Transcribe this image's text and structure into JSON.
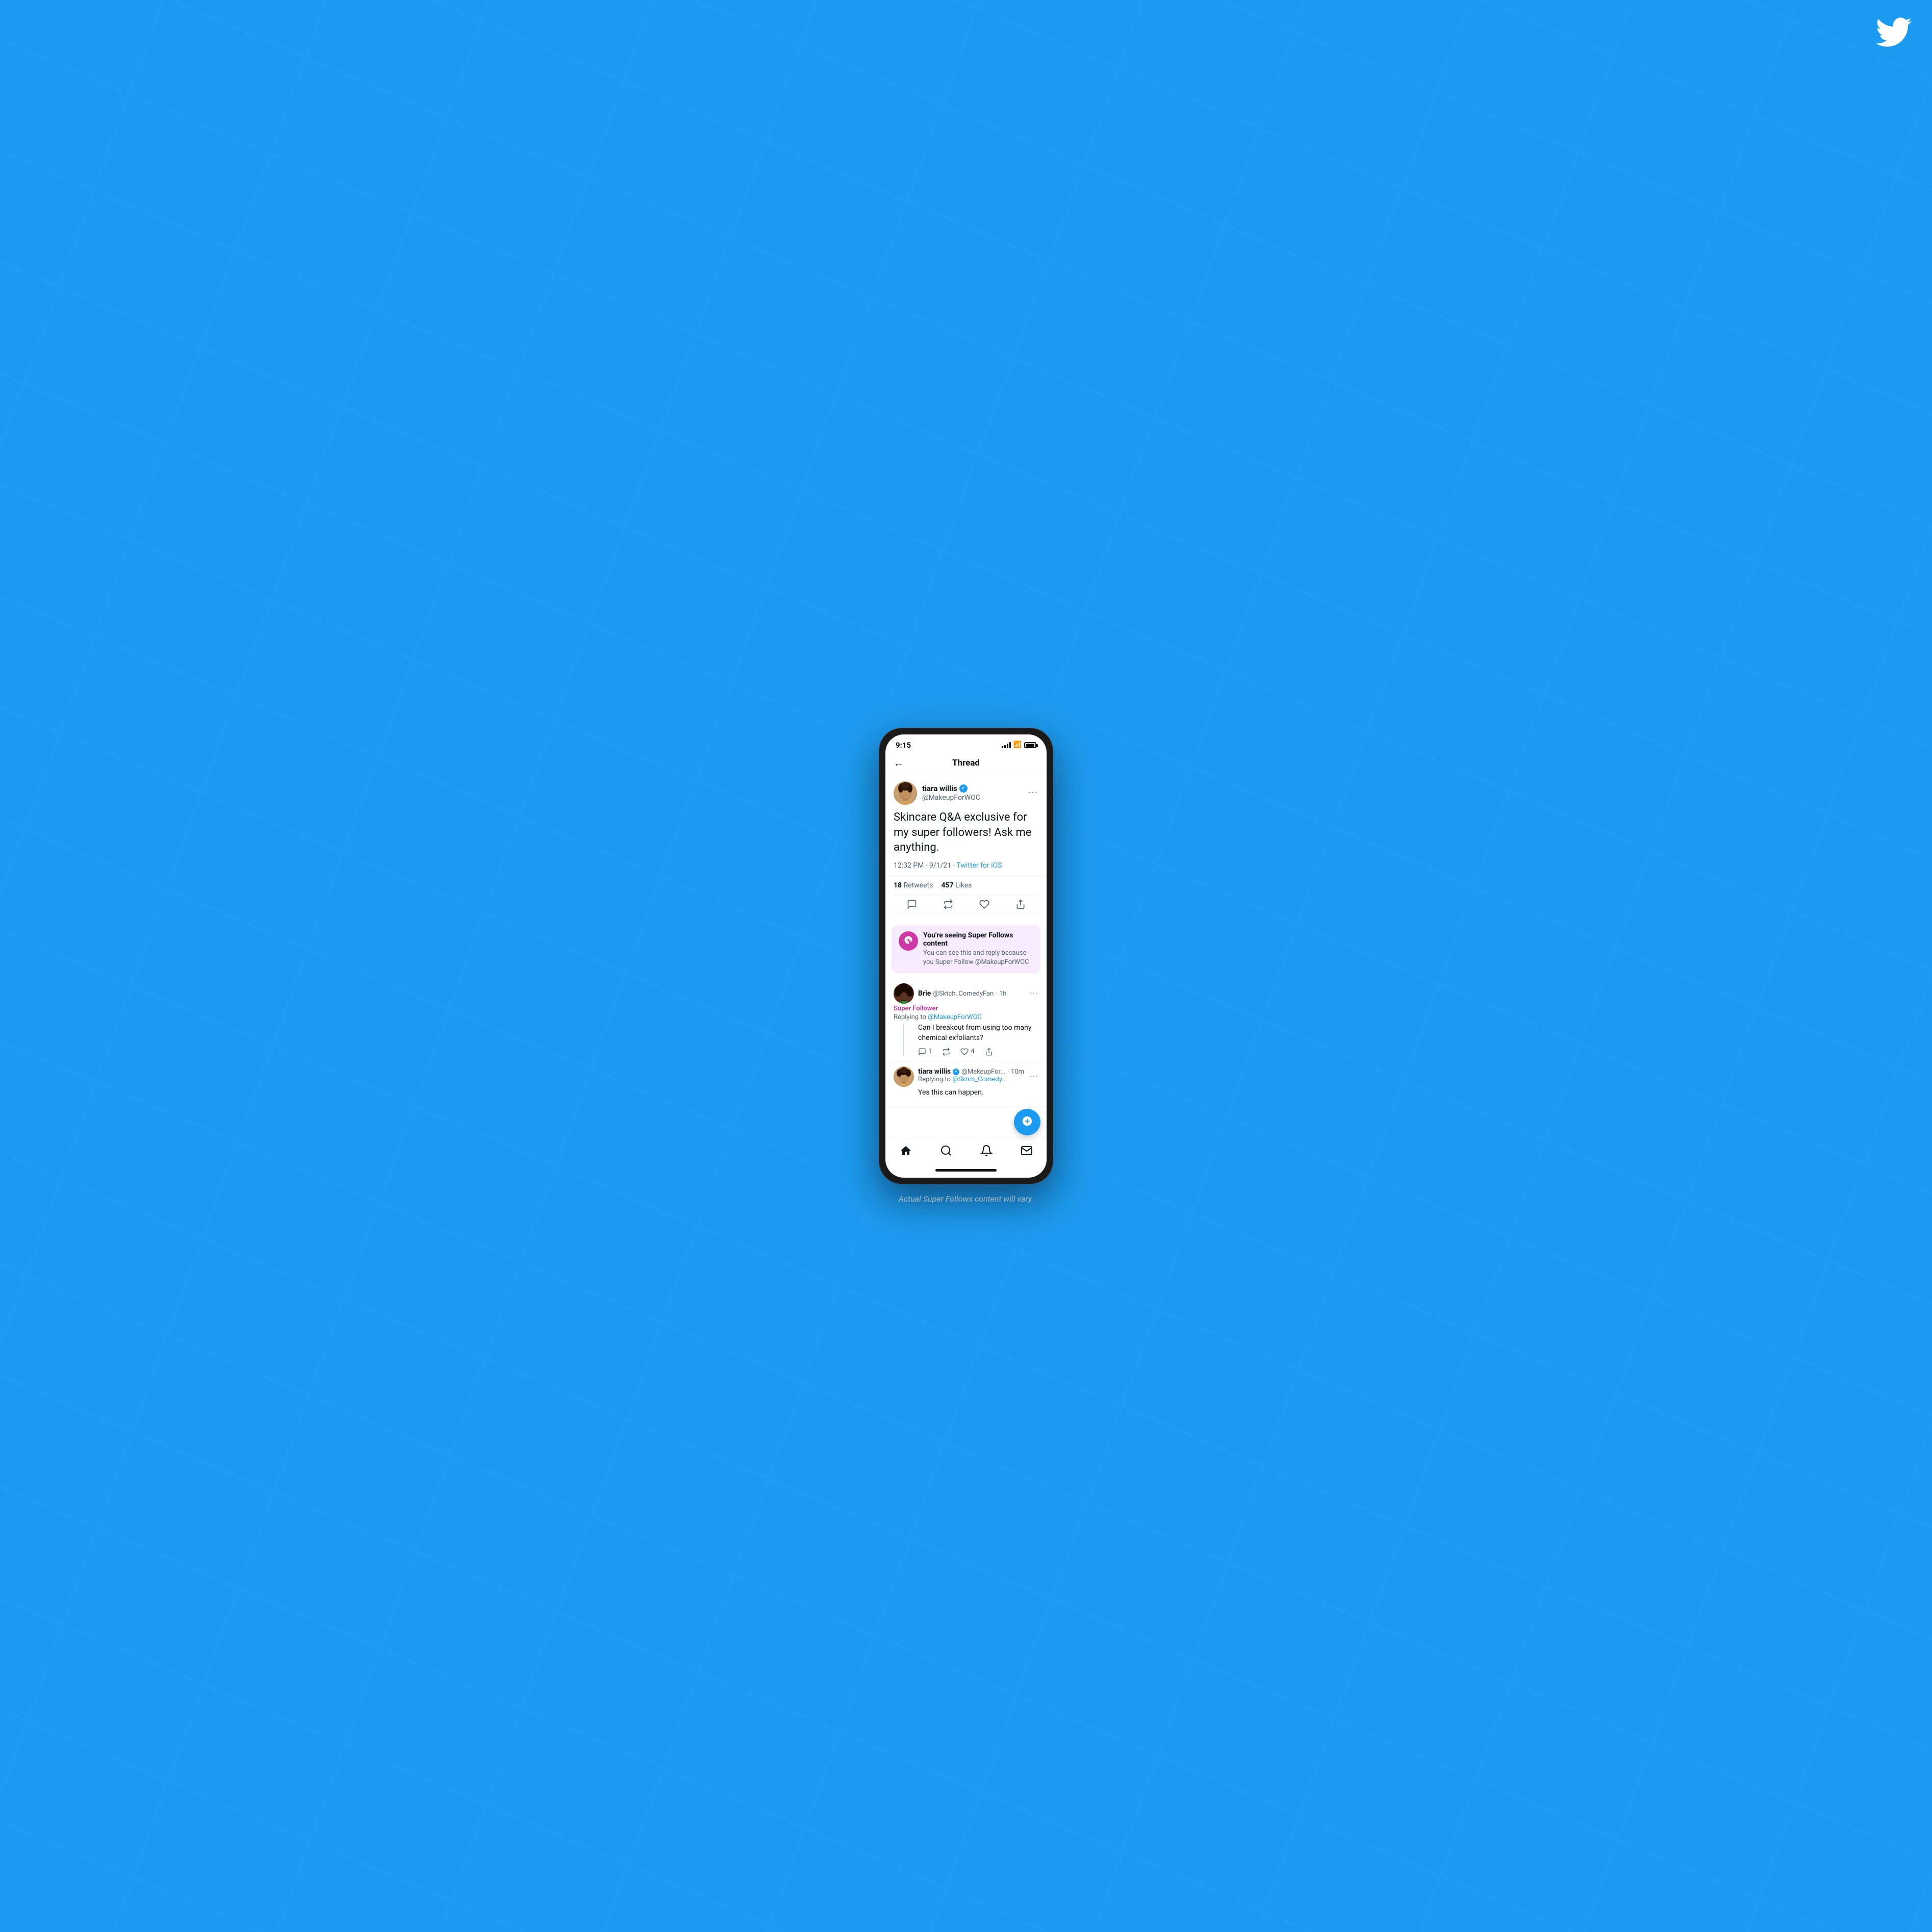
{
  "page": {
    "background_color": "#1d9bf0",
    "disclaimer": "Actual Super Follows content will vary."
  },
  "twitter_logo": {
    "alt": "Twitter bird logo"
  },
  "phone": {
    "status_bar": {
      "time": "9:15",
      "signal_alt": "signal bars",
      "wifi_alt": "wifi",
      "battery_alt": "battery"
    },
    "header": {
      "back_label": "←",
      "title": "Thread"
    },
    "main_tweet": {
      "author": {
        "name": "tiara willis",
        "handle": "@MakeupForWOC",
        "verified": true
      },
      "text": "Skincare Q&A exclusive for my super followers! Ask me anything.",
      "timestamp": "12:32 PM · 9/1/21",
      "source_label": "Twitter for iOS",
      "retweets_label": "Retweets",
      "retweets_count": "18",
      "likes_label": "Likes",
      "likes_count": "457"
    },
    "super_follows_banner": {
      "title": "You're seeing Super Follows content",
      "description": "You can see this and reply because you Super Follow @MakeupForWOC"
    },
    "replies": [
      {
        "author_name": "Brie",
        "author_handle": "@Sktch_ComedyFan",
        "time_ago": "1h",
        "badge": "Super Follower",
        "replying_to_label": "Replying to",
        "replying_to_handle": "@MakeupForWOC",
        "text": "Can I breakout from using too many chemical exfoliants?",
        "reply_count": "1",
        "retweet_count": "",
        "like_count": "4"
      },
      {
        "author_name": "tiara willis",
        "author_handle": "@MakeupFor...",
        "time_ago": "10m",
        "badge": "",
        "replying_to_label": "Replying to",
        "replying_to_handle": "@Sktch_Comedy...",
        "text": "Yes this can happen.",
        "reply_count": "",
        "retweet_count": "",
        "like_count": ""
      }
    ],
    "nav": {
      "home_icon": "🏠",
      "search_icon": "🔍",
      "notifications_icon": "🔔",
      "messages_icon": "✉"
    },
    "compose_fab": {
      "label": "Compose tweet"
    }
  }
}
